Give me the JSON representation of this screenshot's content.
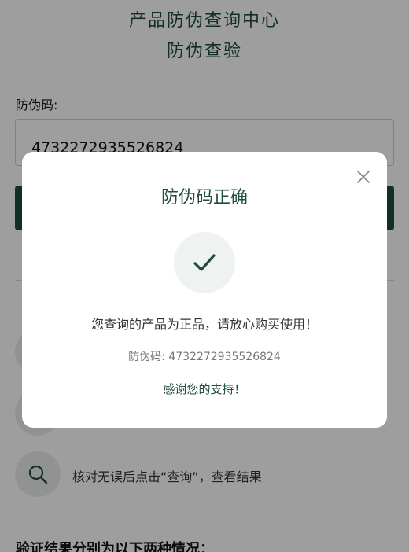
{
  "header": {
    "title": "产品防伪查询中心",
    "subtitle": "防伪查验"
  },
  "form": {
    "label": "防伪码:",
    "value": "4732272935526824"
  },
  "steps": [
    {
      "icon": "search-icon",
      "text": "核对无误后点击“查询”，查看结果"
    }
  ],
  "section": {
    "heading": "验证结果分别为以下两种情况："
  },
  "modal": {
    "title": "防伪码正确",
    "message": "您查询的产品为正品，请放心购买使用！",
    "code_line": "防伪码: 4732272935526824",
    "thanks": "感谢您的支持！"
  },
  "colors": {
    "brand": "#1f4d3a",
    "overlay": "rgba(0,0,0,0.38)"
  }
}
